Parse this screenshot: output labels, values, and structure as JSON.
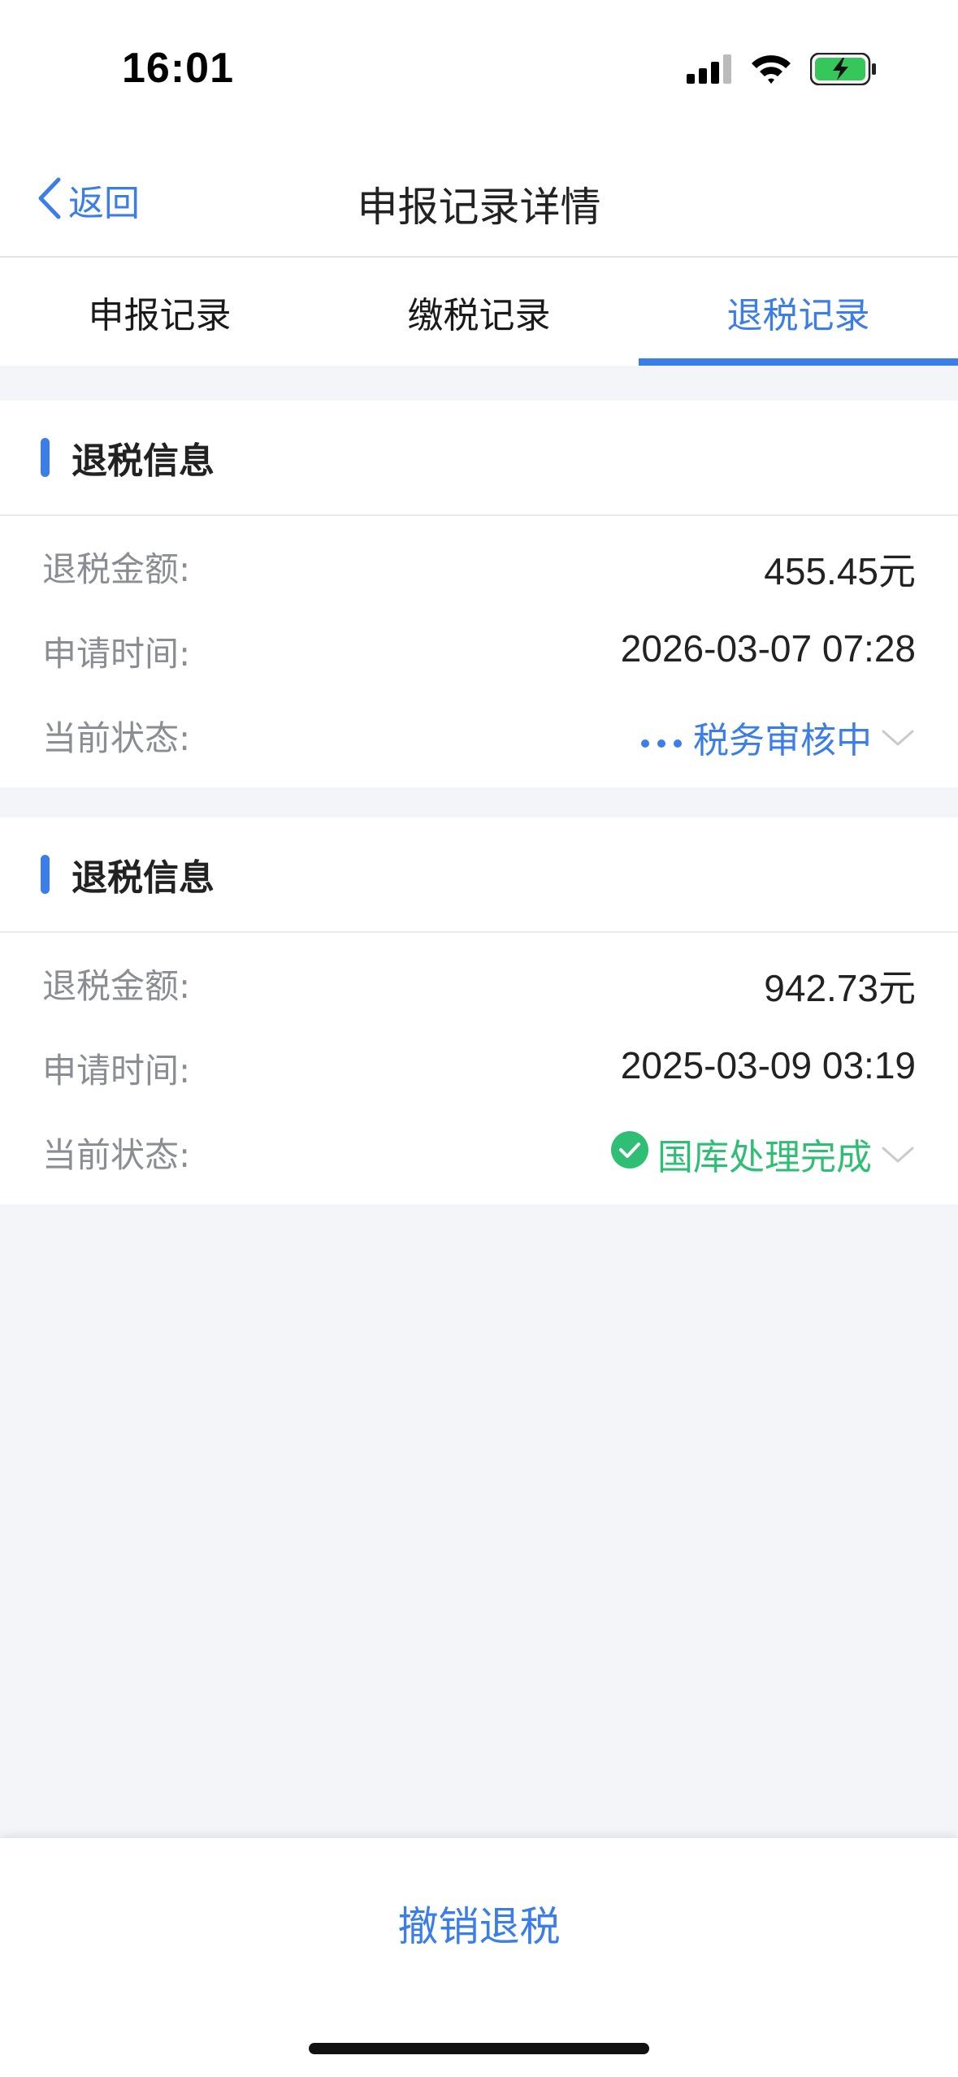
{
  "status_bar": {
    "time": "16:01",
    "icons": [
      "signal-icon",
      "wifi-icon",
      "battery-charging-icon"
    ],
    "battery_color": "#35c759"
  },
  "nav": {
    "back_label": "返回",
    "title": "申报记录详情",
    "accent_color": "#3b7ee8"
  },
  "tabs": [
    {
      "label": "申报记录",
      "active": false
    },
    {
      "label": "缴税记录",
      "active": false
    },
    {
      "label": "退税记录",
      "active": true
    }
  ],
  "records": [
    {
      "title": "退税信息",
      "amount_label": "退税金额:",
      "amount_value": "455.45元",
      "time_label": "申请时间:",
      "time_value": "2026-03-07 07:28",
      "status_label": "当前状态:",
      "status_value": "税务审核中",
      "status_icon": "more-dots-icon",
      "status_color": "#3b7ee8"
    },
    {
      "title": "退税信息",
      "amount_label": "退税金额:",
      "amount_value": "942.73元",
      "time_label": "申请时间:",
      "time_value": "2025-03-09 03:19",
      "status_label": "当前状态:",
      "status_value": "国库处理完成",
      "status_icon": "check-circle-icon",
      "status_color": "#2fbf74"
    }
  ],
  "bottom": {
    "cancel_label": "撤销退税"
  }
}
